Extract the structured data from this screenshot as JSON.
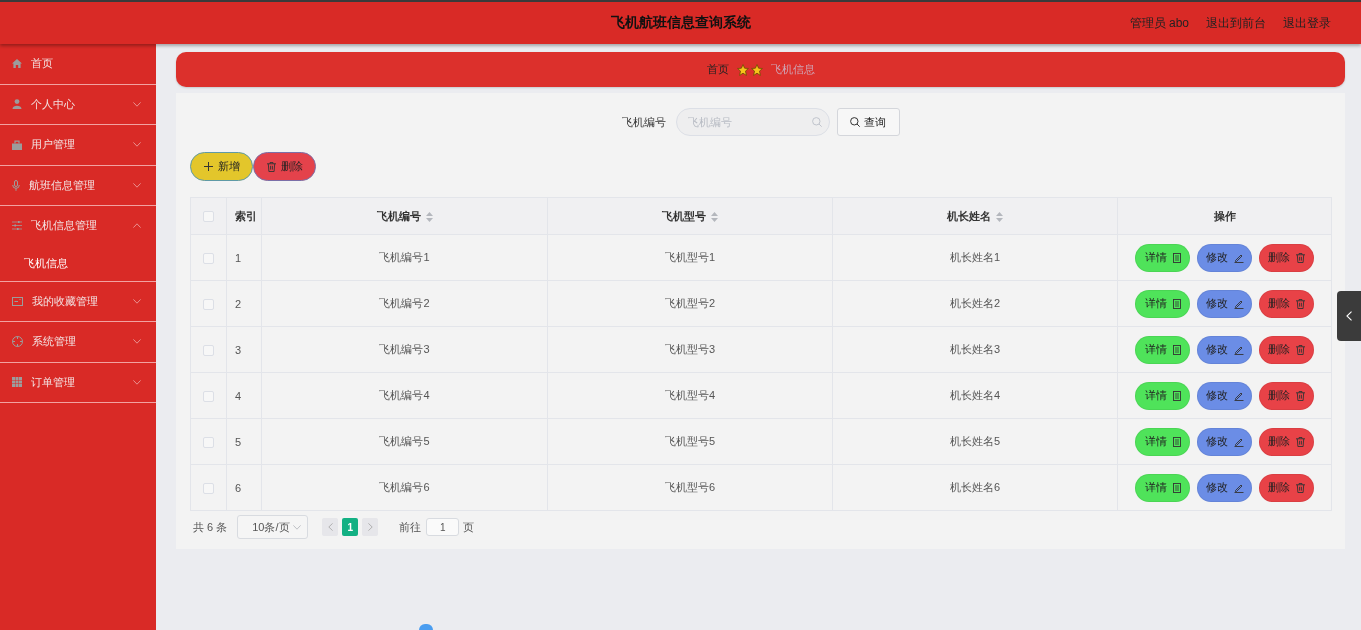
{
  "header": {
    "title": "飞机航班信息查询系统",
    "user": "管理员 abo",
    "links": [
      "退出到前台",
      "退出登录"
    ]
  },
  "sidebar": {
    "items": [
      {
        "label": "首页",
        "kind": "link"
      },
      {
        "label": "个人中心",
        "kind": "group",
        "expanded": false
      },
      {
        "label": "用户管理",
        "kind": "group",
        "expanded": false
      },
      {
        "label": "航班信息管理",
        "kind": "group",
        "expanded": false
      },
      {
        "label": "飞机信息管理",
        "kind": "group",
        "expanded": true,
        "children": [
          {
            "label": "飞机信息"
          }
        ]
      },
      {
        "label": "我的收藏管理",
        "kind": "group",
        "expanded": false
      },
      {
        "label": "系统管理",
        "kind": "group",
        "expanded": false
      },
      {
        "label": "订单管理",
        "kind": "group",
        "expanded": false
      }
    ]
  },
  "breadcrumb": {
    "items": [
      "首页",
      "飞机信息"
    ]
  },
  "search": {
    "label": "飞机编号",
    "placeholder": "飞机编号",
    "button": "查询"
  },
  "toolbar": {
    "buttons": [
      {
        "label": "新增",
        "kind": "add"
      },
      {
        "label": "删除",
        "kind": "delete"
      }
    ]
  },
  "table": {
    "select_all": {
      "checked": false
    },
    "columns": [
      {
        "label": "索引",
        "sortable": false
      },
      {
        "label": "飞机编号",
        "sortable": true
      },
      {
        "label": "飞机型号",
        "sortable": true
      },
      {
        "label": "机长姓名",
        "sortable": true
      },
      {
        "label": "操作",
        "sortable": false
      }
    ],
    "rows": [
      {
        "checked": false,
        "cells": [
          "1",
          "飞机编号1",
          "飞机型号1",
          "机长姓名1"
        ],
        "actions": [
          {
            "label": "详情",
            "kind": "detail"
          },
          {
            "label": "修改",
            "kind": "edit"
          },
          {
            "label": "删除",
            "kind": "delete"
          }
        ]
      },
      {
        "checked": false,
        "cells": [
          "2",
          "飞机编号2",
          "飞机型号2",
          "机长姓名2"
        ],
        "actions": [
          {
            "label": "详情",
            "kind": "detail"
          },
          {
            "label": "修改",
            "kind": "edit"
          },
          {
            "label": "删除",
            "kind": "delete"
          }
        ]
      },
      {
        "checked": false,
        "cells": [
          "3",
          "飞机编号3",
          "飞机型号3",
          "机长姓名3"
        ],
        "actions": [
          {
            "label": "详情",
            "kind": "detail"
          },
          {
            "label": "修改",
            "kind": "edit"
          },
          {
            "label": "删除",
            "kind": "delete"
          }
        ]
      },
      {
        "checked": false,
        "cells": [
          "4",
          "飞机编号4",
          "飞机型号4",
          "机长姓名4"
        ],
        "actions": [
          {
            "label": "详情",
            "kind": "detail"
          },
          {
            "label": "修改",
            "kind": "edit"
          },
          {
            "label": "删除",
            "kind": "delete"
          }
        ]
      },
      {
        "checked": false,
        "cells": [
          "5",
          "飞机编号5",
          "飞机型号5",
          "机长姓名5"
        ],
        "actions": [
          {
            "label": "详情",
            "kind": "detail"
          },
          {
            "label": "修改",
            "kind": "edit"
          },
          {
            "label": "删除",
            "kind": "delete"
          }
        ]
      },
      {
        "checked": false,
        "cells": [
          "6",
          "飞机编号6",
          "飞机型号6",
          "机长姓名6"
        ],
        "actions": [
          {
            "label": "详情",
            "kind": "detail"
          },
          {
            "label": "修改",
            "kind": "edit"
          },
          {
            "label": "删除",
            "kind": "delete"
          }
        ]
      }
    ]
  },
  "pagination": {
    "total": "共 6 条",
    "page_size": "10条/页",
    "pages": [
      {
        "label": "1",
        "selected": true
      }
    ],
    "goto_label": "前往",
    "goto_value": "1",
    "goto_suffix": "页"
  }
}
